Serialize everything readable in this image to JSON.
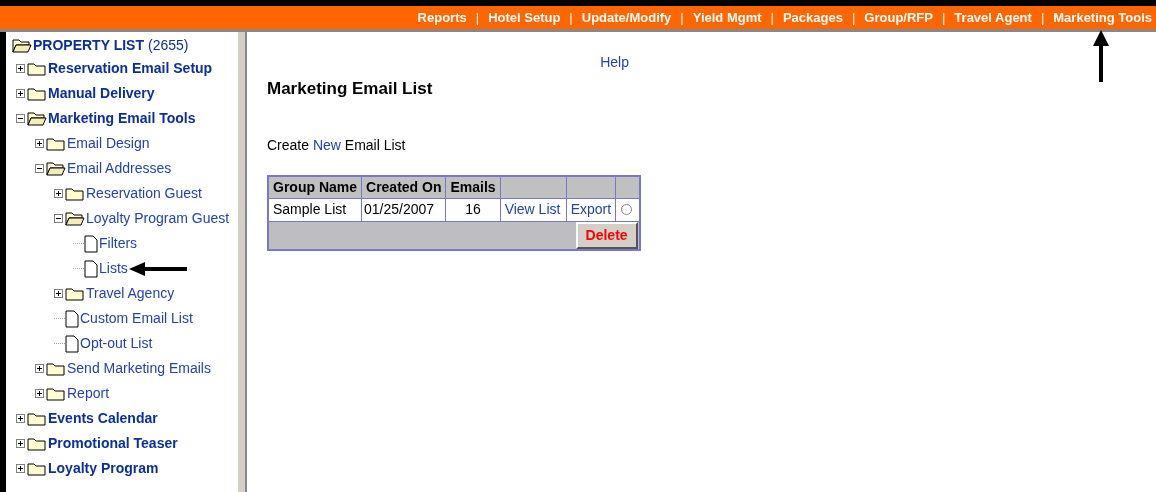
{
  "nav": [
    {
      "label": "Reports"
    },
    {
      "label": "Hotel Setup"
    },
    {
      "label": "Update/Modify"
    },
    {
      "label": "Yield Mgmt"
    },
    {
      "label": "Packages"
    },
    {
      "label": "Group/RFP"
    },
    {
      "label": "Travel Agent"
    },
    {
      "label": "Marketing Tools"
    }
  ],
  "nav_separator": "|",
  "tree": {
    "title": "PROPERTY LIST",
    "count": "(2655)",
    "children": [
      {
        "label": "Reservation Email Setup",
        "kind": "folder",
        "expanded": false
      },
      {
        "label": "Manual Delivery",
        "kind": "folder",
        "expanded": false
      },
      {
        "label": "Marketing Email Tools",
        "kind": "folder",
        "expanded": true,
        "children": [
          {
            "label": "Email Design",
            "kind": "folder",
            "expanded": false
          },
          {
            "label": "Email Addresses",
            "kind": "folder",
            "expanded": true,
            "children": [
              {
                "label": "Reservation Guest",
                "kind": "folder",
                "expanded": false
              },
              {
                "label": "Loyalty Program Guest",
                "kind": "folder",
                "expanded": true,
                "children": [
                  {
                    "label": "Filters",
                    "kind": "page"
                  },
                  {
                    "label": "Lists",
                    "kind": "page"
                  }
                ]
              },
              {
                "label": "Travel Agency",
                "kind": "folder",
                "expanded": false
              },
              {
                "label": "Custom Email List",
                "kind": "page"
              },
              {
                "label": "Opt-out List",
                "kind": "page"
              }
            ]
          },
          {
            "label": "Send Marketing Emails",
            "kind": "folder",
            "expanded": false
          },
          {
            "label": "Report",
            "kind": "folder",
            "expanded": false
          }
        ]
      },
      {
        "label": "Events Calendar",
        "kind": "folder",
        "expanded": false
      },
      {
        "label": "Promotional Teaser",
        "kind": "folder",
        "expanded": false
      },
      {
        "label": "Loyalty Program",
        "kind": "folder",
        "expanded": false
      }
    ]
  },
  "help": "Help",
  "heading": "Marketing Email List",
  "create": {
    "before": "Create ",
    "link": "New",
    "after": " Email List"
  },
  "table": {
    "columns": [
      "Group Name",
      "Created On",
      "Emails"
    ],
    "rows": [
      {
        "group_name": "Sample List",
        "created_on": "01/25/2007",
        "emails": "16",
        "view": "View List",
        "export": "Export",
        "selected": false
      }
    ],
    "delete": "Delete"
  }
}
